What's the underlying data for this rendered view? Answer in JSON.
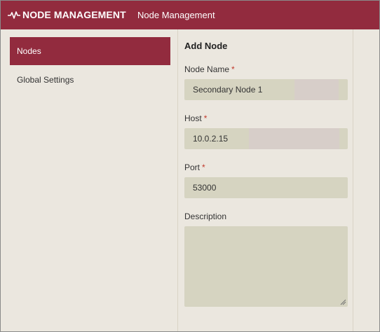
{
  "header": {
    "brand": "NODE MANAGEMENT",
    "nav_label": "Node Management",
    "bg_color": "#922b3e"
  },
  "sidebar": {
    "items": [
      {
        "label": "Nodes",
        "active": true
      },
      {
        "label": "Global Settings",
        "active": false
      }
    ]
  },
  "form": {
    "title": "Add Node",
    "fields": {
      "node_name": {
        "label": "Node Name",
        "required_mark": "*",
        "value": "Secondary Node 1"
      },
      "host": {
        "label": "Host",
        "required_mark": "*",
        "value": "10.0.2.15"
      },
      "port": {
        "label": "Port",
        "required_mark": "*",
        "value": "53000"
      },
      "description": {
        "label": "Description",
        "value": ""
      }
    }
  }
}
